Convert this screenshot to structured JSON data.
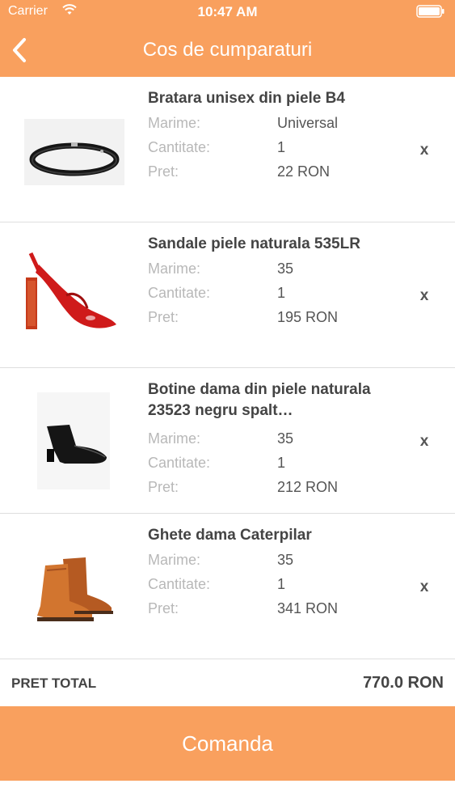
{
  "status": {
    "carrier": "Carrier",
    "time": "10:47 AM"
  },
  "nav": {
    "title": "Cos de cumparaturi",
    "back_icon": "chevron-left-icon"
  },
  "labels": {
    "size": "Marime:",
    "quantity": "Cantitate:",
    "price": "Pret:",
    "remove": "x"
  },
  "items": [
    {
      "title": "Bratara unisex din piele B4",
      "size": "Universal",
      "quantity": "1",
      "price": "22 RON",
      "image": "bracelet"
    },
    {
      "title": "Sandale piele naturala 535LR",
      "size": "35",
      "quantity": "1",
      "price": "195 RON",
      "image": "red-sandal"
    },
    {
      "title": "Botine dama din piele naturala 23523 negru spalt…",
      "size": "35",
      "quantity": "1",
      "price": "212 RON",
      "image": "black-bootie"
    },
    {
      "title": "Ghete dama Caterpilar",
      "size": "35",
      "quantity": "1",
      "price": "341 RON",
      "image": "tan-boots"
    }
  ],
  "total": {
    "label": "PRET TOTAL",
    "value": "770.0 RON"
  },
  "order": {
    "label": "Comanda"
  },
  "colors": {
    "accent": "#f9a05e"
  }
}
